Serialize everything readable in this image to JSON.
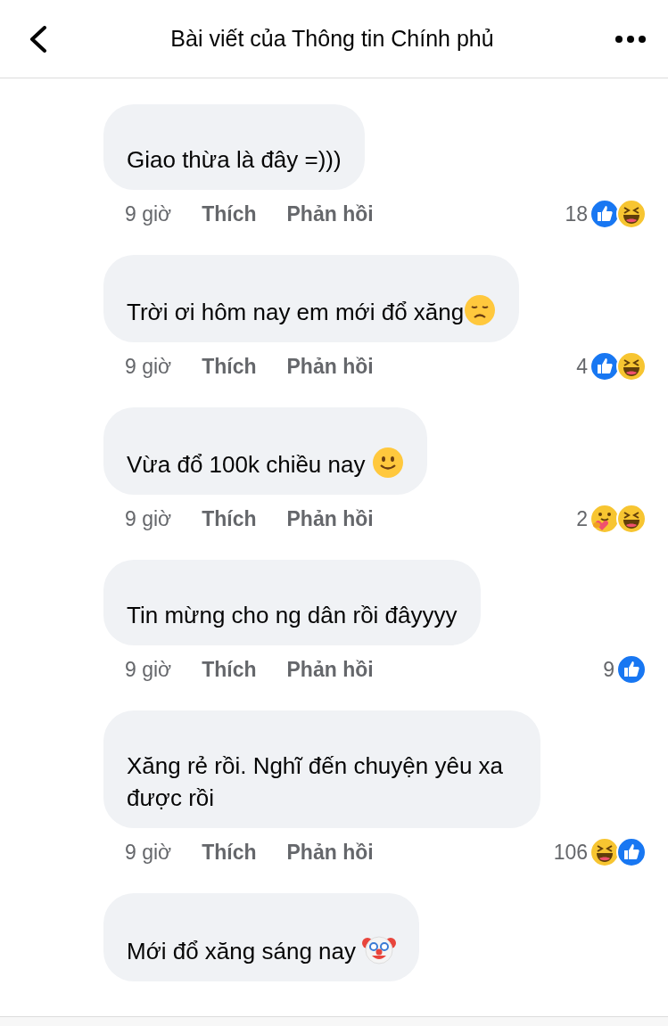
{
  "header": {
    "title": "Bài viết của Thông tin Chính phủ"
  },
  "comments": [
    {
      "text": "Giao thừa là đây =)))",
      "time": "9 giờ",
      "like_label": "Thích",
      "reply_label": "Phản hồi",
      "reaction_count": "18",
      "reactions": [
        {
          "kind": "like"
        },
        {
          "kind": "haha"
        }
      ]
    },
    {
      "text": "Trời ơi hôm nay em mới đổ xăng",
      "emoji": {
        "kind": "sad"
      },
      "time": "9 giờ",
      "like_label": "Thích",
      "reply_label": "Phản hồi",
      "reaction_count": "4",
      "reactions": [
        {
          "kind": "like"
        },
        {
          "kind": "haha"
        }
      ]
    },
    {
      "text": "Vừa đổ 100k chiều nay",
      "emoji": {
        "kind": "smile"
      },
      "time": "9 giờ",
      "like_label": "Thích",
      "reply_label": "Phản hồi",
      "reaction_count": "2",
      "reactions": [
        {
          "kind": "care"
        },
        {
          "kind": "haha"
        }
      ]
    },
    {
      "text": "Tin mừng cho ng dân rồi đâyyyy",
      "time": "9 giờ",
      "like_label": "Thích",
      "reply_label": "Phản hồi",
      "reaction_count": "9",
      "reactions": [
        {
          "kind": "like"
        }
      ]
    },
    {
      "text": "Xăng rẻ rồi. Nghĩ đến chuyện yêu xa được rồi",
      "time": "9 giờ",
      "like_label": "Thích",
      "reply_label": "Phản hồi",
      "reaction_count": "106",
      "reactions": [
        {
          "kind": "haha"
        },
        {
          "kind": "like"
        }
      ]
    },
    {
      "text": "Mới đổ xăng sáng nay",
      "emoji": {
        "kind": "clown"
      }
    }
  ]
}
